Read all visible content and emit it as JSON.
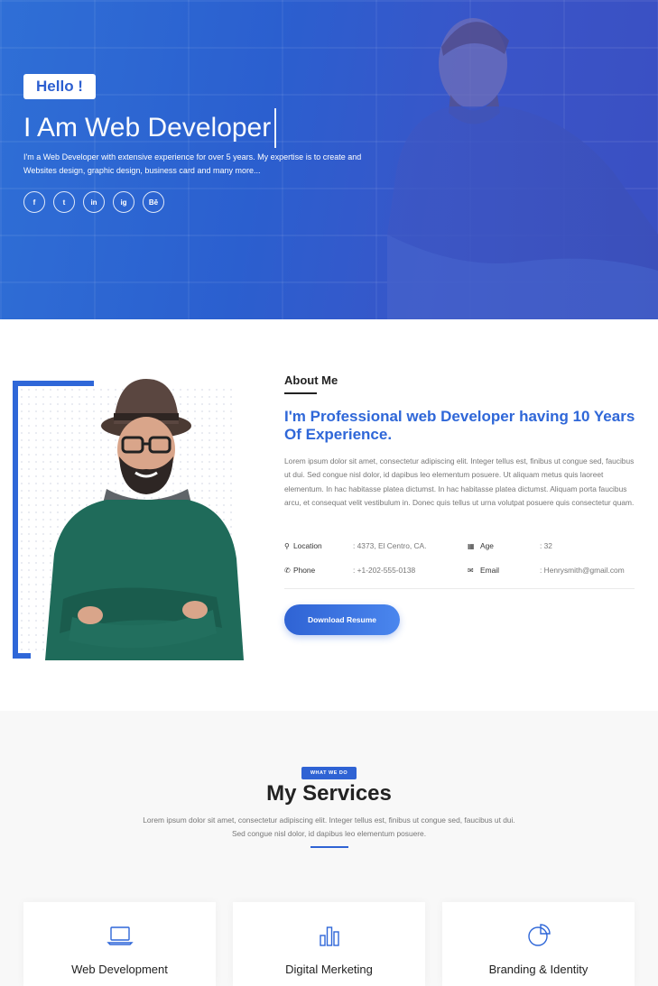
{
  "hero": {
    "hello": "Hello !",
    "title_strong": "I Am",
    "title_light": "Web Developer",
    "description": "I'm a Web Developer with extensive experience for over 5 years. My expertise is to create and Websites design, graphic design, business card and many more...",
    "socials": [
      "f",
      "t",
      "in",
      "ig",
      "Bē"
    ]
  },
  "about": {
    "heading": "About Me",
    "title": "I'm Professional web Developer having 10 Years Of Experience.",
    "text": "Lorem ipsum dolor sit amet, consectetur adipiscing elit. Integer tellus est, finibus ut congue sed, faucibus ut dui. Sed congue nisl dolor, id dapibus leo elementum posuere. Ut aliquam metus quis laoreet elementum. In hac habitasse platea dictumst. In hac habitasse platea dictumst. Aliquam porta faucibus arcu, et consequat velit vestibulum in. Donec quis tellus ut urna volutpat posuere quis consectetur quam.",
    "info": {
      "location_label": "Location",
      "location_value": ": 4373, El Centro, CA.",
      "age_label": "Age",
      "age_value": ": 32",
      "phone_label": "Phone",
      "phone_value": ": +1-202-555-0138",
      "email_label": "Email",
      "email_value": ": Henrysmith@gmail.com"
    },
    "download": "Download Resume"
  },
  "services": {
    "badge": "WHAT WE DO",
    "title": "My Services",
    "description": "Lorem ipsum dolor sit amet, consectetur adipiscing elit. Integer tellus est, finibus ut congue sed, faucibus ut dui. Sed congue nisl dolor, id dapibus leo elementum posuere.",
    "cards": [
      {
        "title": "Web Development",
        "icon": "laptop-icon"
      },
      {
        "title": "Digital Merketing",
        "icon": "bar-chart-icon"
      },
      {
        "title": "Branding & Identity",
        "icon": "pie-chart-icon"
      }
    ]
  },
  "colors": {
    "accent": "#2f67d8",
    "hero_bg": "#2b5fcf"
  }
}
